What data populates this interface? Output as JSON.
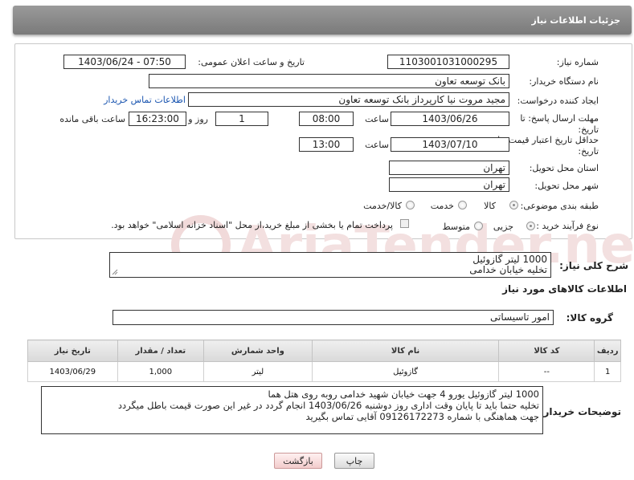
{
  "header": {
    "title": "جزئیات اطلاعات نیاز"
  },
  "form": {
    "need_number": {
      "label": "شماره نیاز:",
      "value": "1103001031000295"
    },
    "announce_datetime": {
      "label": "تاریخ و ساعت اعلان عمومی:",
      "value": "1403/06/24 - 07:50"
    },
    "buyer_org": {
      "label": "نام دستگاه خریدار:",
      "value": "بانک توسعه تعاون"
    },
    "creator": {
      "label": "ایجاد کننده درخواست:",
      "value": "مجید مروت نیا کارپرداز بانک توسعه تعاون"
    },
    "contact_link": "اطلاعات تماس خریدار",
    "reply_deadline": {
      "label": "مهلت ارسال پاسخ: تا تاریخ:",
      "date": "1403/06/26",
      "time_label": "ساعت",
      "time": "08:00",
      "days": "1",
      "days_label": "روز و",
      "remaining": "16:23:00",
      "remaining_label": "ساعت باقی مانده"
    },
    "price_validity": {
      "label": "حداقل تاریخ اعتبار قیمت: تا تاریخ:",
      "date": "1403/07/10",
      "time_label": "ساعت",
      "time": "13:00"
    },
    "province": {
      "label": "استان محل تحویل:",
      "value": "تهران"
    },
    "city": {
      "label": "شهر محل تحویل:",
      "value": "تهران"
    },
    "category": {
      "label": "طبقه بندی موضوعی:",
      "options": [
        "کالا",
        "خدمت",
        "کالا/خدمت"
      ],
      "selected": "کالا"
    },
    "purchase_type": {
      "label": "نوع فرآیند خرید :",
      "options": [
        "جزیی",
        "متوسط"
      ],
      "selected": "جزیی",
      "payment_note": "پرداخت تمام یا بخشی از مبلغ خرید،از محل \"اسناد خزانه اسلامی\" خواهد بود."
    }
  },
  "description": {
    "label": "شرح کلی نیاز:",
    "line1": "1000 لیتر گازوئیل",
    "line2": "تخلیه خیابان خدامی"
  },
  "goods_section": {
    "title": "اطلاعات کالاهای مورد نیاز",
    "group_label": "گروه کالا:",
    "group_value": "امور تاسیساتی"
  },
  "table": {
    "headers": [
      "ردیف",
      "کد کالا",
      "نام کالا",
      "واحد شمارش",
      "تعداد / مقدار",
      "تاریخ نیاز"
    ],
    "rows": [
      {
        "row": "1",
        "code": "--",
        "name": "گازوئیل",
        "unit": "لیتر",
        "qty": "1,000",
        "date": "1403/06/29"
      }
    ]
  },
  "buyer_notes": {
    "label": "توضیحات خریدار:",
    "line1": "1000 لیتر گازوئیل یورو 4 جهت خیابان شهید خدامی روبه روی هتل هما",
    "line2": "تخلیه حتما باید تا پایان وقت اداری روز دوشنبه 1403/06/26 انجام گردد در غیر این صورت قیمت باطل میگردد",
    "line3": "جهت هماهنگی با شماره 09126172273 آقایی تماس بگیرید"
  },
  "buttons": {
    "print": "چاپ",
    "back": "بازگشت"
  },
  "watermark": {
    "text": "AriaTender.neT"
  },
  "colors": {
    "header": "#8a8a8a",
    "link": "#1a55b0",
    "watermark": "#f2dede"
  }
}
